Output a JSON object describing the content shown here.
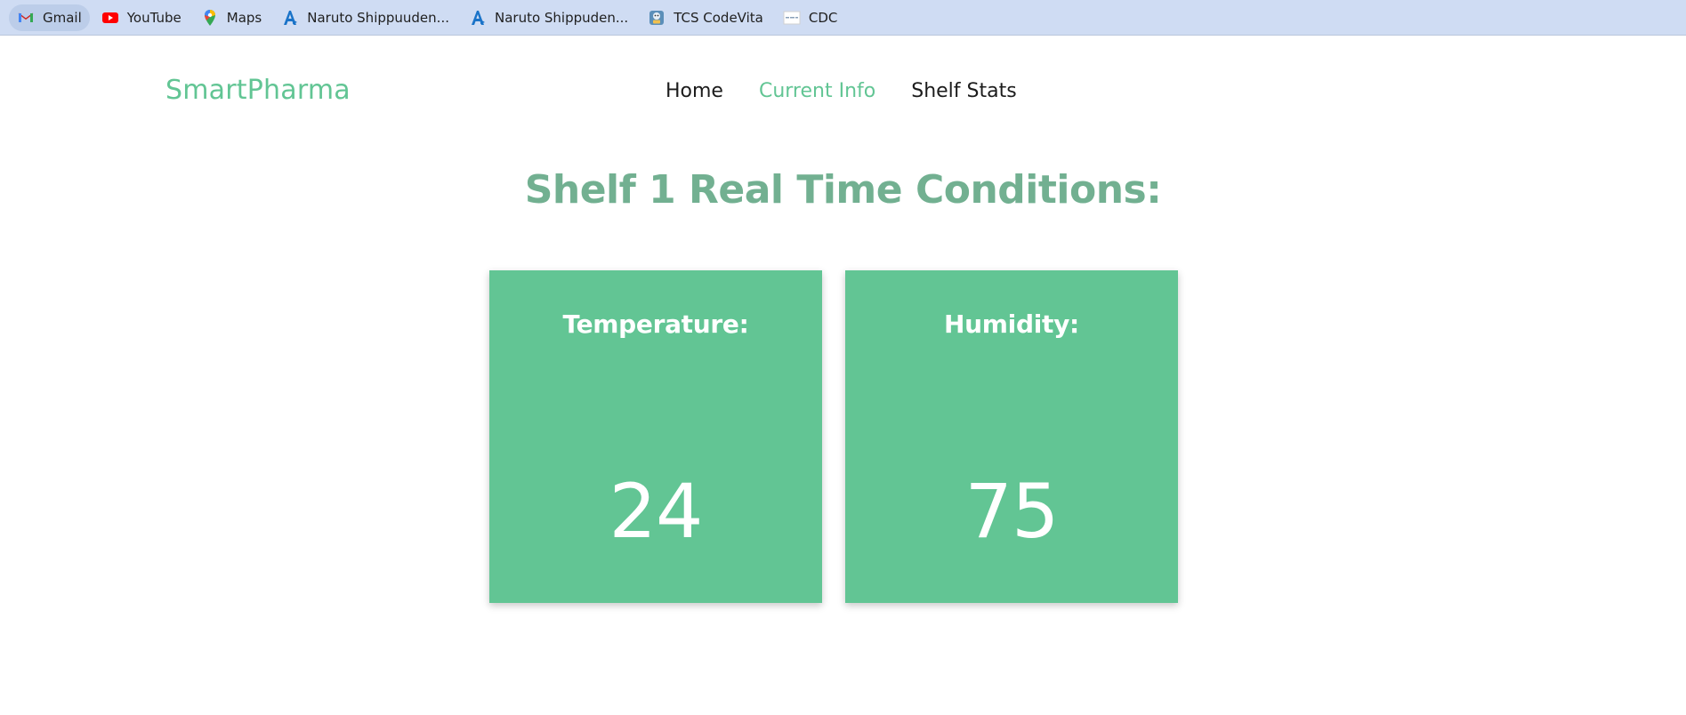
{
  "bookmarks": [
    {
      "label": "Gmail",
      "icon": "gmail-icon"
    },
    {
      "label": "YouTube",
      "icon": "youtube-icon"
    },
    {
      "label": "Maps",
      "icon": "maps-icon"
    },
    {
      "label": "Naruto Shippuuden...",
      "icon": "anime-site-icon"
    },
    {
      "label": "Naruto Shippuden...",
      "icon": "anime-site-icon"
    },
    {
      "label": "TCS CodeVita",
      "icon": "codevita-icon"
    },
    {
      "label": "CDC",
      "icon": "cdc-icon"
    }
  ],
  "site": {
    "brand": "SmartPharma",
    "nav": {
      "home": "Home",
      "current_info": "Current Info",
      "shelf_stats": "Shelf Stats"
    }
  },
  "main": {
    "heading": "Shelf 1 Real Time Conditions:",
    "cards": {
      "temperature": {
        "label": "Temperature:",
        "value": "24"
      },
      "humidity": {
        "label": "Humidity:",
        "value": "75"
      }
    }
  },
  "colors": {
    "accent": "#62c594",
    "heading": "#72b091",
    "bookmarks_bar": "#cfdcf3"
  }
}
